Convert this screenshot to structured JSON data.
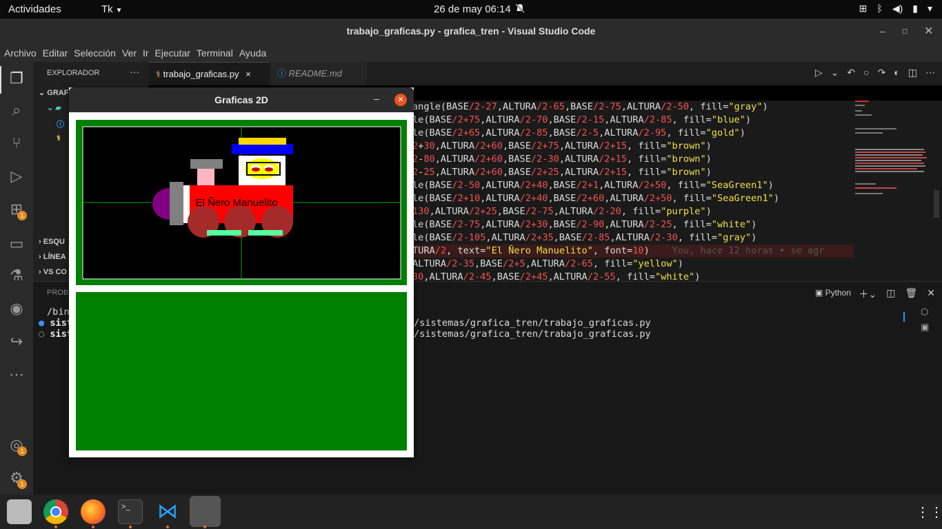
{
  "topbar": {
    "activities": "Actividades",
    "app": "Tk",
    "clock": "26 de may  06:14"
  },
  "window": {
    "title": "trabajo_graficas.py - grafica_tren - Visual Studio Code"
  },
  "menu": [
    "Archivo",
    "Editar",
    "Selección",
    "Ver",
    "Ir",
    "Ejecutar",
    "Terminal",
    "Ayuda"
  ],
  "sidebar": {
    "header": "EXPLORADOR",
    "folder": "GRAF",
    "sections": [
      "ESQU",
      "LÍNEA",
      "VS CO"
    ]
  },
  "activity_badges": {
    "extensions": "1",
    "accounts": "1",
    "settings": "1"
  },
  "tabs": [
    {
      "label": "trabajo_graficas.py",
      "close": "×"
    },
    {
      "label": "README.md"
    }
  ],
  "code_lines": [
    "angle(BASE/2-27,ALTURA/2-65,BASE/2-75,ALTURA/2-50, fill=\"gray\")",
    "le(BASE/2+75,ALTURA/2-70,BASE/2-15,ALTURA/2-85, fill=\"blue\")",
    "le(BASE/2+65,ALTURA/2-85,BASE/2-5,ALTURA/2-95, fill=\"gold\")",
    "2+30,ALTURA/2+60,BASE/2+75,ALTURA/2+15, fill=\"brown\")",
    "2-80,ALTURA/2+60,BASE/2-30,ALTURA/2+15, fill=\"brown\")",
    "2-25,ALTURA/2+60,BASE/2+25,ALTURA/2+15, fill=\"brown\")",
    "le(BASE/2-50,ALTURA/2+40,BASE/2+1,ALTURA/2+50, fill=\"SeaGreen1\")",
    "le(BASE/2+10,ALTURA/2+40,BASE/2+60,ALTURA/2+50, fill=\"SeaGreen1\")",
    "130,ALTURA/2+25,BASE/2-75,ALTURA/2-20, fill=\"purple\")",
    "le(BASE/2-75,ALTURA/2+30,BASE/2-90,ALTURA/2-25, fill=\"white\")",
    "le(BASE/2-105,ALTURA/2+35,BASE/2-85,ALTURA/2-30, fill=\"gray\")",
    "TURA/2, text=\"El Ñero Manuelito\", font=10)",
    "ALTURA/2-35,BASE/2+5,ALTURA/2-65, fill=\"yellow\")",
    "30,ALTURA/2-45,BASE/2+45,ALTURA/2-55, fill=\"white\")"
  ],
  "blame": "You, hace 12 horas • se agr",
  "panel": {
    "header": "PROB",
    "terminal_name": "Python",
    "lines": [
      {
        "prefix": "/bin",
        "text": ""
      },
      {
        "prefix": "sist",
        "text": "/sistemas/grafica_tren/trabajo_graficas.py"
      },
      {
        "prefix": "sist",
        "text": "/sistemas/grafica_tren/trabajo_graficas.py"
      }
    ]
  },
  "tk": {
    "title": "Graficas 2D",
    "train_label": "El Ñero Manuelito"
  }
}
